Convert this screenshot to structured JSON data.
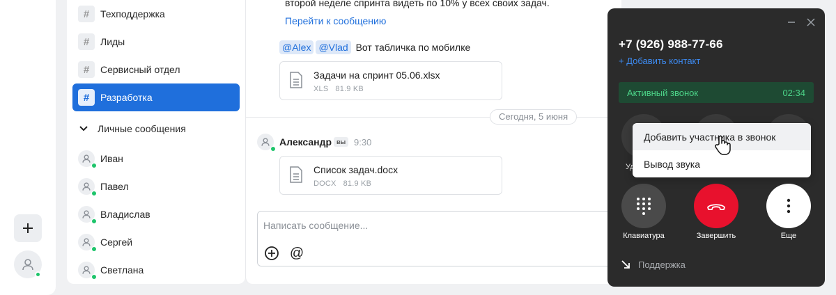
{
  "rail": {
    "add_icon": "plus-icon",
    "avatar_icon": "user-icon"
  },
  "channels": [
    {
      "label": "Техподдержка"
    },
    {
      "label": "Лиды"
    },
    {
      "label": "Сервисный отдел"
    },
    {
      "label": "Разработка",
      "active": true
    }
  ],
  "direct_section": {
    "label": "Личные сообщения"
  },
  "contacts": [
    {
      "name": "Иван"
    },
    {
      "name": "Павел"
    },
    {
      "name": "Владислав"
    },
    {
      "name": "Сергей"
    },
    {
      "name": "Светлана"
    }
  ],
  "chat": {
    "prev_text": "второй неделе спринта видеть по 10% у всех своих задач.",
    "goto_link": "Перейти к сообщению",
    "mention1": "@Alex",
    "mention2": "@Vlad",
    "mention_text": "Вот табличка по мобилке",
    "file1": {
      "name": "Задачи на спринт 05.06.xlsx",
      "type": "XLS",
      "size": "81.9 KB"
    },
    "date_divider": "Сегодня, 5 июня",
    "author": "Александр",
    "you_badge": "вы",
    "time": "9:30",
    "file2": {
      "name": "Список задач.docx",
      "type": "DOCX",
      "size": "81.9 KB"
    },
    "composer_placeholder": "Написать сообщение..."
  },
  "call": {
    "phone": "+7 (926) 988-77-66",
    "add_contact": "+ Добавить контакт",
    "status": "Активный звонок",
    "duration": "02:34",
    "hidden_label_fragment": "Уд",
    "keypad_label": "Клавиатура",
    "end_label": "Завершить",
    "more_label": "Еще",
    "support_label": "Поддержка",
    "end_color": "#e8112d",
    "active_color": "#4cd388"
  },
  "more_menu": {
    "items": [
      {
        "label": "Добавить участника в звонок"
      },
      {
        "label": "Вывод звука"
      }
    ]
  }
}
